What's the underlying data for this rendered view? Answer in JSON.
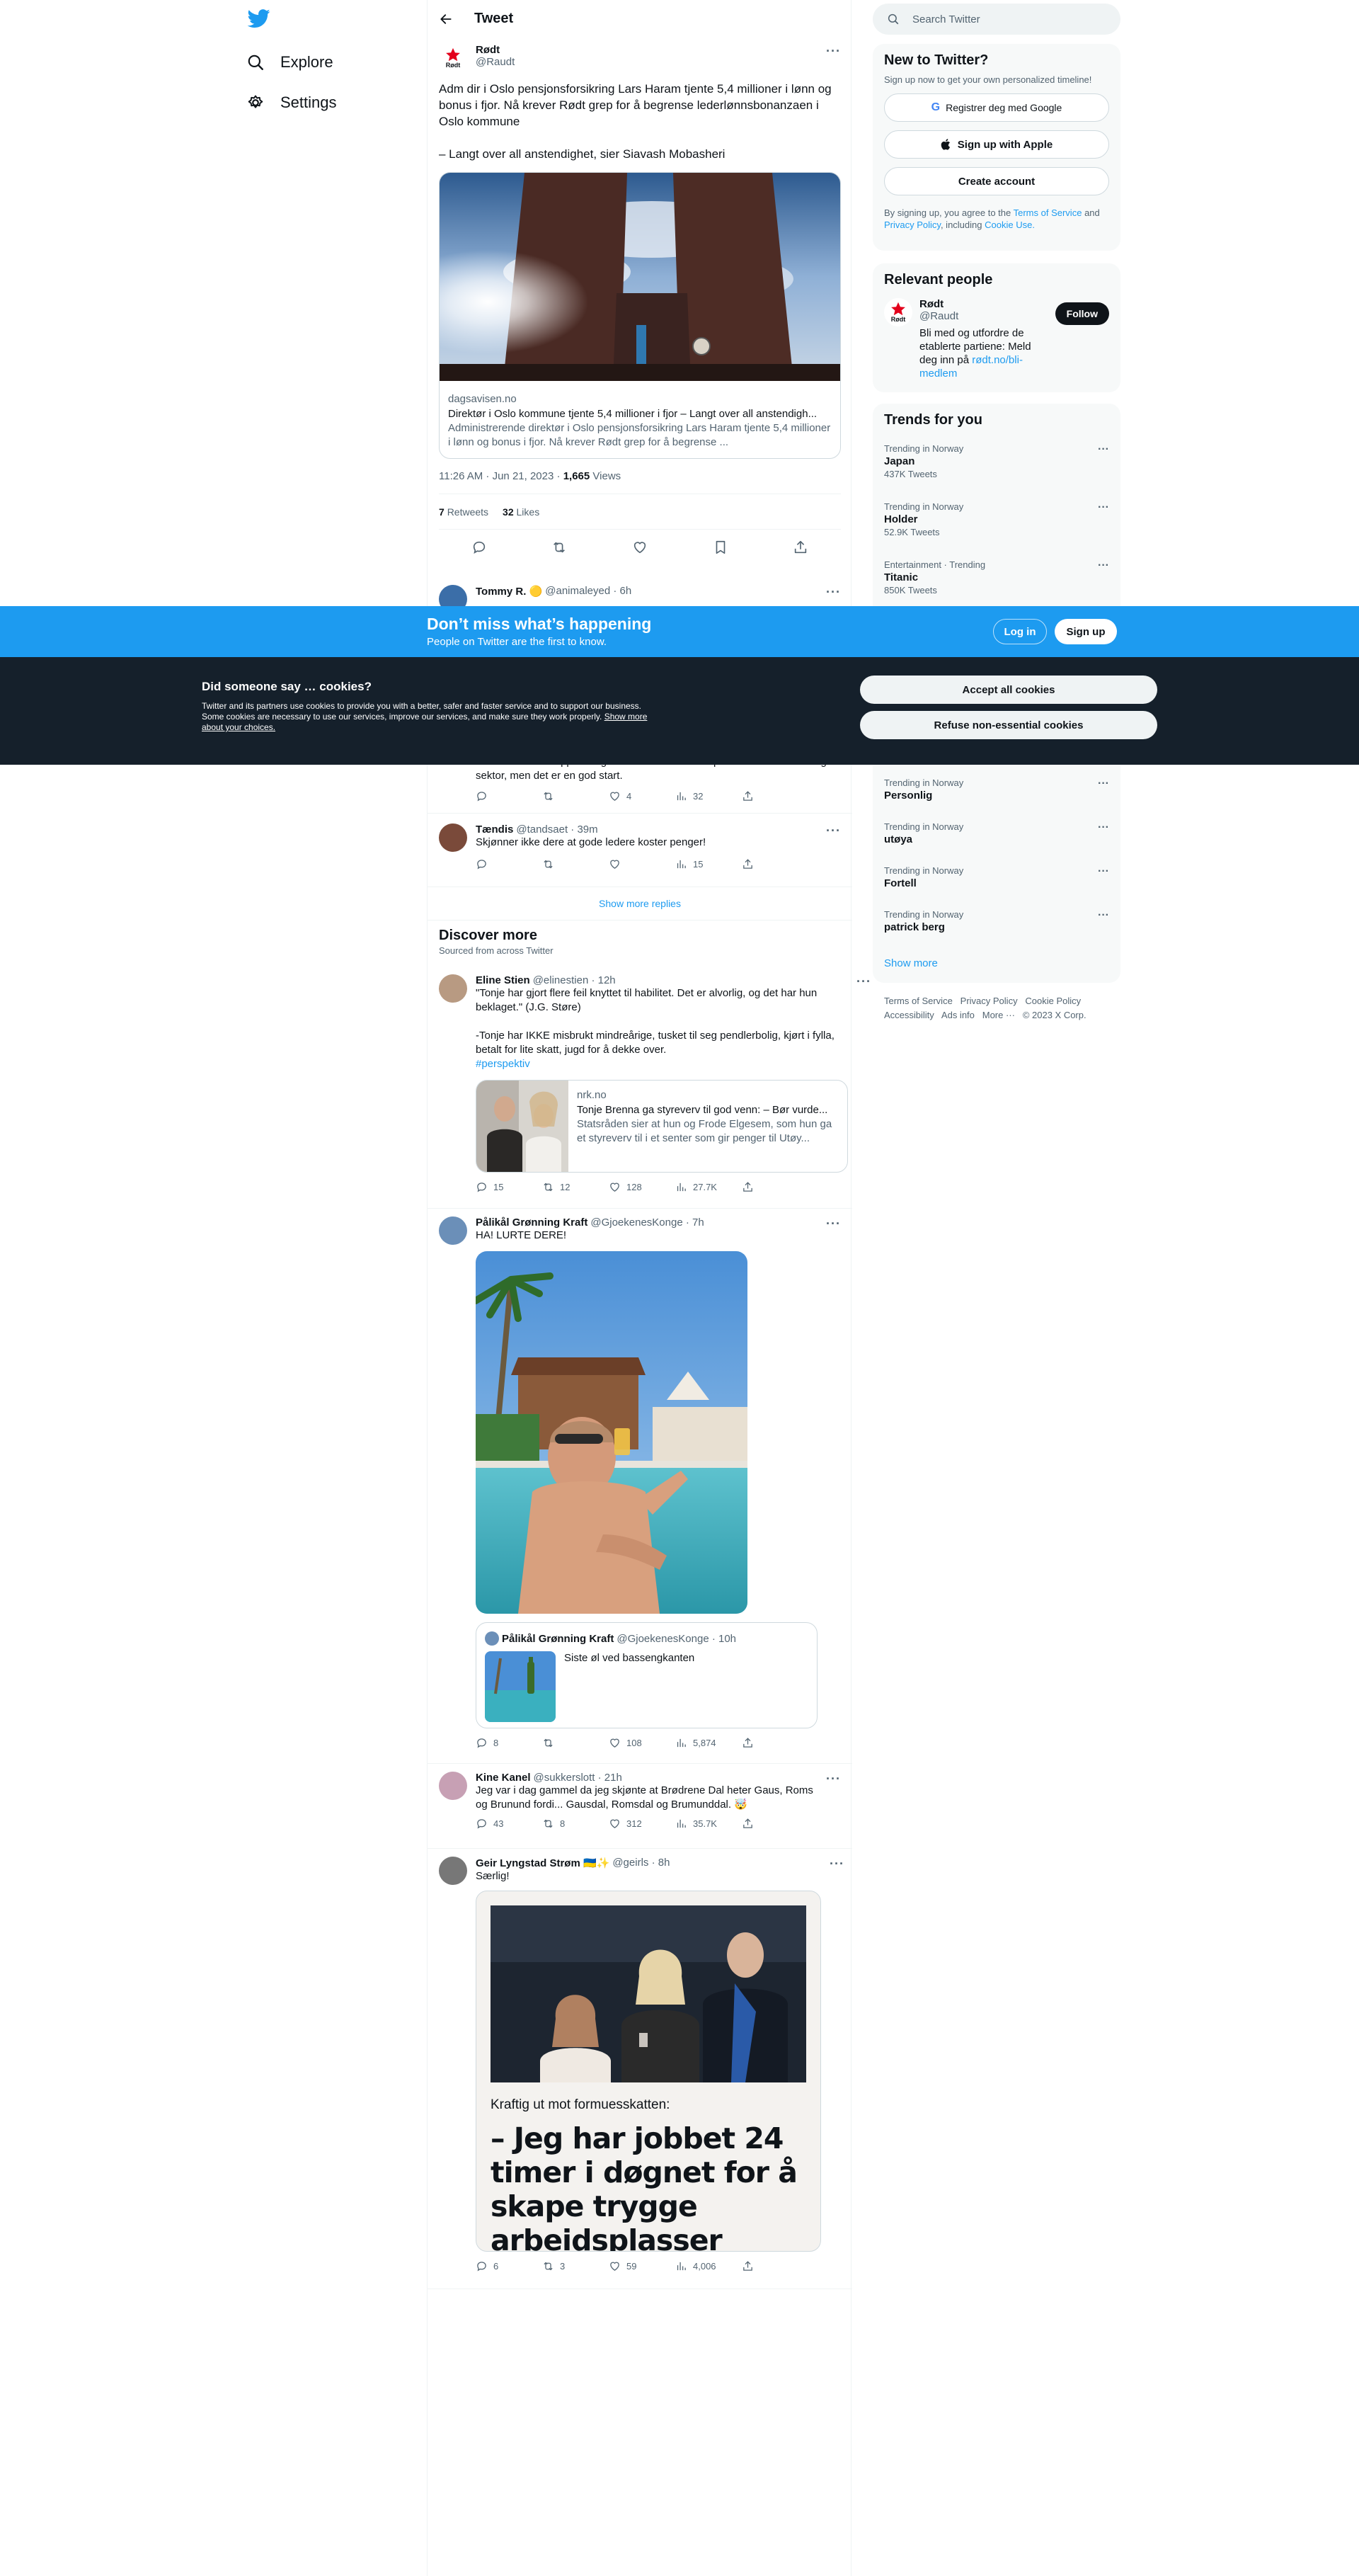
{
  "nav": {
    "explore": "Explore",
    "settings": "Settings"
  },
  "header": {
    "title": "Tweet"
  },
  "main_tweet": {
    "name": "Rødt",
    "handle": "@Raudt",
    "text1": "Adm dir i Oslo pensjonsforsikring Lars Haram tjente 5,4 millioner i lønn og bonus i fjor. Nå krever Rødt grep for å begrense lederlønnsbonanzaen i Oslo kommune",
    "text2": "– Langt over all anstendighet, sier Siavash Mobasheri",
    "link": {
      "domain": "dagsavisen.no",
      "title": "Direktør i Oslo kommune tjente 5,4 millioner i fjor – Langt over all anstendigh...",
      "desc": "Administrerende direktør i Oslo pensjonsforsikring Lars Haram tjente 5,4 millioner i lønn og bonus i fjor. Nå krever Rødt grep for å begrense ..."
    },
    "time": "11:26 AM · Jun 21, 2023",
    "views_count": "1,665",
    "views_label": "Views",
    "retweets_count": "7",
    "retweets_label": "Retweets",
    "likes_count": "32",
    "likes_label": "Likes"
  },
  "replies": [
    {
      "name": "Tommy R. 🟡",
      "handle": "@animaleyed · 6h"
    },
    {
      "text": "Haddet det vært opp til meg hadde i hvertfall en cap i lederlønner i offentlig sektor, men det er en god start.",
      "likes": "4",
      "views": "32"
    },
    {
      "name": "Tændis",
      "handle": "@tandsaet · 39m",
      "text": "Skjønner ikke dere at gode ledere koster penger!",
      "views": "15"
    }
  ],
  "show_more_replies": "Show more replies",
  "discover": {
    "title": "Discover more",
    "subtitle": "Sourced from across Twitter"
  },
  "discover_tweets": [
    {
      "name": "Eline Stien",
      "handle": "@elinestien · 12h",
      "text1": "\"Tonje har gjort flere feil knyttet til habilitet. Det er alvorlig, og det har hun beklaget.\" (J.G. Støre)",
      "text2": "-Tonje har IKKE misbrukt mindreårige, tusket til seg pendlerbolig, kjørt i fylla, betalt for lite skatt, jugd for å dekke over.",
      "hashtag": "#perspektiv",
      "card_domain": "nrk.no",
      "card_title": "Tonje Brenna ga styreverv til god venn: – Bør vurde...",
      "card_desc": "Statsråden sier at hun og Frode Elgesem, som hun ga et styreverv til i et senter som gir penger til Utøy...",
      "replies": "15",
      "retweets": "12",
      "likes": "128",
      "views": "27.7K"
    },
    {
      "name": "Pålikål Grønning Kraft",
      "handle": "@GjoekenesKonge · 7h",
      "text": "HA! LURTE DERE!",
      "quote_name": "Pålikål Grønning Kraft",
      "quote_handle": "@GjoekenesKonge · 10h",
      "quote_text": "Siste øl ved bassengkanten",
      "replies": "8",
      "likes": "108",
      "views": "5,874"
    },
    {
      "name": "Kine Kanel",
      "handle": "@sukkerslott · 21h",
      "text": "Jeg var i dag gammel da jeg skjønte at Brødrene Dal heter Gaus, Roms og Brunund fordi... Gausdal, Romsdal og Brumunddal. 🤯",
      "replies": "43",
      "retweets": "8",
      "likes": "312",
      "views": "35.7K"
    },
    {
      "name": "Geir Lyngstad Strøm 🇺🇦✨",
      "handle": "@geirls · 8h",
      "text": "Særlig!",
      "image_caption": "Kraftig ut mot formuesskatten:",
      "image_headline": "– Jeg har jobbet 24 timer i døgnet for å skape trygge arbeidsplasser",
      "replies": "6",
      "retweets": "3",
      "likes": "59",
      "views": "4,006"
    }
  ],
  "search": {
    "placeholder": "Search Twitter"
  },
  "new_to_twitter": {
    "title": "New to Twitter?",
    "subtitle": "Sign up now to get your own personalized timeline!",
    "google": "Registrer deg med Google",
    "apple": "Sign up with Apple",
    "create": "Create account",
    "legal_pre": "By signing up, you agree to the",
    "terms": "Terms of Service",
    "and": "and",
    "privacy": "Privacy Policy",
    "including": ", including",
    "cookie": "Cookie Use."
  },
  "relevant": {
    "title": "Relevant people",
    "name": "Rødt",
    "handle": "@Raudt",
    "follow": "Follow",
    "bio": "Bli med og utfordre de etablerte partiene: Meld deg inn på",
    "bio_link": "rødt.no/bli-medlem"
  },
  "trends": {
    "title": "Trends for you",
    "items": [
      {
        "context": "Trending in Norway",
        "name": "Japan",
        "count": "437K Tweets"
      },
      {
        "context": "Trending in Norway",
        "name": "Holder",
        "count": "52.9K Tweets"
      },
      {
        "context": "Entertainment · Trending",
        "name": "Titanic",
        "count": "850K Tweets"
      },
      {
        "context": "Trending in Norway",
        "name": "Personlig",
        "count": ""
      },
      {
        "context": "Trending in Norway",
        "name": "utøya",
        "count": ""
      },
      {
        "context": "Trending in Norway",
        "name": "Fortell",
        "count": ""
      },
      {
        "context": "Trending in Norway",
        "name": "patrick berg",
        "count": ""
      }
    ],
    "show_more": "Show more"
  },
  "footer": {
    "terms": "Terms of Service",
    "privacy": "Privacy Policy",
    "cookie": "Cookie Policy",
    "accessibility": "Accessibility",
    "ads": "Ads info",
    "more": "More ···",
    "copyright": "© 2023 X Corp."
  },
  "signup_bar": {
    "title": "Don’t miss what’s happening",
    "subtitle": "People on Twitter are the first to know.",
    "login": "Log in",
    "signup": "Sign up"
  },
  "cookies": {
    "title": "Did someone say … cookies?",
    "body": "Twitter and its partners use cookies to provide you with a better, safer and faster service and to support our business. Some cookies are necessary to use our services, improve our services, and make sure they work properly.",
    "link": "Show more about your choices.",
    "accept": "Accept all cookies",
    "refuse": "Refuse non-essential cookies"
  },
  "colors": {
    "accent": "#1d9bf0",
    "dark": "#0f1419",
    "cookie_bg": "#15202b"
  }
}
